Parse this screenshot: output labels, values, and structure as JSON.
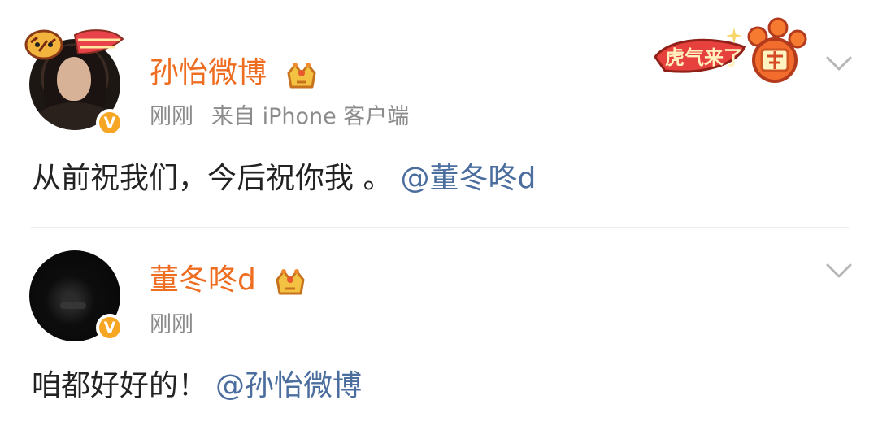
{
  "posts": [
    {
      "username": "孙怡微博",
      "time": "刚刚",
      "source": "来自 iPhone 客户端",
      "text": "从前祝我们，今后祝你我 。",
      "mention": "@董冬咚d",
      "badge_text": "V",
      "decoration_text": "虎气来了"
    },
    {
      "username": "董冬咚d",
      "time": "刚刚",
      "text": "咱都好好的！",
      "mention": "@孙怡微博",
      "badge_text": "V"
    }
  ],
  "colors": {
    "username": "#ee6d20",
    "mention": "#4b6e9f",
    "meta": "#8b8b8b",
    "verified": "#f6a623",
    "divider": "#ececec"
  },
  "icons": {
    "verified": "verified-badge-icon",
    "crown": "crown-icon",
    "expand": "chevron-down-icon",
    "decoration": "tiger-paw-decoration"
  }
}
